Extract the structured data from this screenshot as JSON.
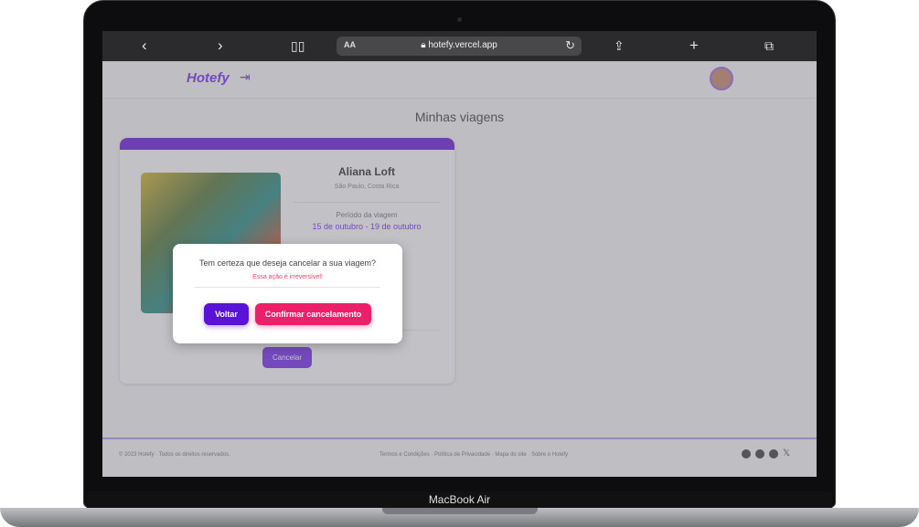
{
  "device": {
    "model_label": "MacBook Air"
  },
  "browser": {
    "url_display": "hotefy.vercel.app",
    "text_size_label": "AA",
    "icons": [
      "back-icon",
      "forward-icon",
      "bookmarks-icon",
      "lock-icon",
      "reload-icon",
      "share-icon",
      "new-tab-icon",
      "tabs-icon"
    ]
  },
  "header": {
    "logo": "Hotefy"
  },
  "main": {
    "title": "Minhas viagens",
    "trip": {
      "hotel_name": "Aliana Loft",
      "location": "São Paulo, Costa Rica",
      "period_label": "Período da viagem",
      "period_value": "15 de outubro - 19 de outubro",
      "cancel_label": "Cancelar"
    }
  },
  "modal": {
    "question": "Tem certeza que deseja cancelar a sua viagem?",
    "warning": "Essa ação é irreversível!",
    "back_label": "Voltar",
    "confirm_label": "Confirmar cancelamento"
  },
  "footer": {
    "copyright": "© 2023 Hotefy · Todos os direitos reservados.",
    "links": "Termos e Condições · Política de Privacidade · Mapa do site · Sobre o Hotefy"
  },
  "colors": {
    "brand": "#6b1fd6",
    "danger": "#ec1f68",
    "warning_text": "#e64560"
  }
}
